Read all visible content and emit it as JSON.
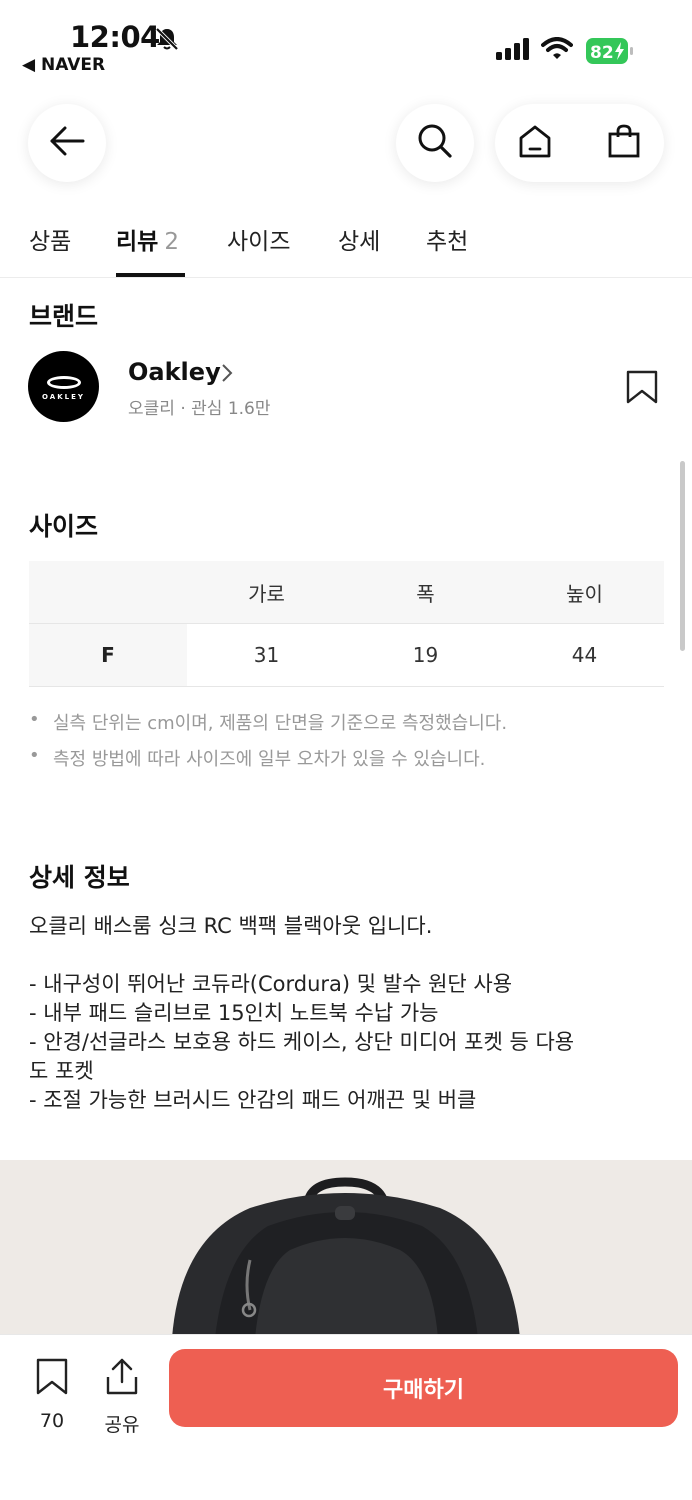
{
  "status_bar": {
    "time": "12:04",
    "back_app": "◀ NAVER",
    "battery": "82"
  },
  "tabs": [
    {
      "label": "상품"
    },
    {
      "label": "리뷰",
      "count": "2"
    },
    {
      "label": "사이즈"
    },
    {
      "label": "상세"
    },
    {
      "label": "추천"
    }
  ],
  "active_tab": "리뷰",
  "brand": {
    "section_title": "브랜드",
    "logo_text": "OAKLEY",
    "name": "Oakley",
    "subtitle": "오클리 · 관심 1.6만"
  },
  "size": {
    "section_title": "사이즈",
    "columns": [
      "",
      "가로",
      "폭",
      "높이"
    ],
    "rows": [
      [
        "F",
        "31",
        "19",
        "44"
      ]
    ],
    "notes": [
      "실측 단위는 cm이며, 제품의 단면을 기준으로 측정했습니다.",
      "측정 방법에 따라 사이즈에 일부 오차가 있을 수 있습니다."
    ]
  },
  "detail": {
    "section_title": "상세 정보",
    "intro": "오클리 배스룸 싱크 RC 백팩 블랙아웃 입니다.",
    "lines": [
      "- 내구성이 뛰어난 코듀라(Cordura) 및 발수 원단 사용",
      "- 내부 패드 슬리브로 15인치 노트북 수납 가능",
      "- 안경/선글라스 보호용 하드 케이스, 상단 미디어 포켓 등 다용",
      "도 포켓",
      "- 조절 가능한 브러시드 안감의 패드 어깨끈 및 버클"
    ]
  },
  "bottom_bar": {
    "bookmark_count": "70",
    "share_label": "공유",
    "buy_label": "구매하기",
    "buy_color": "#ee5f52"
  }
}
